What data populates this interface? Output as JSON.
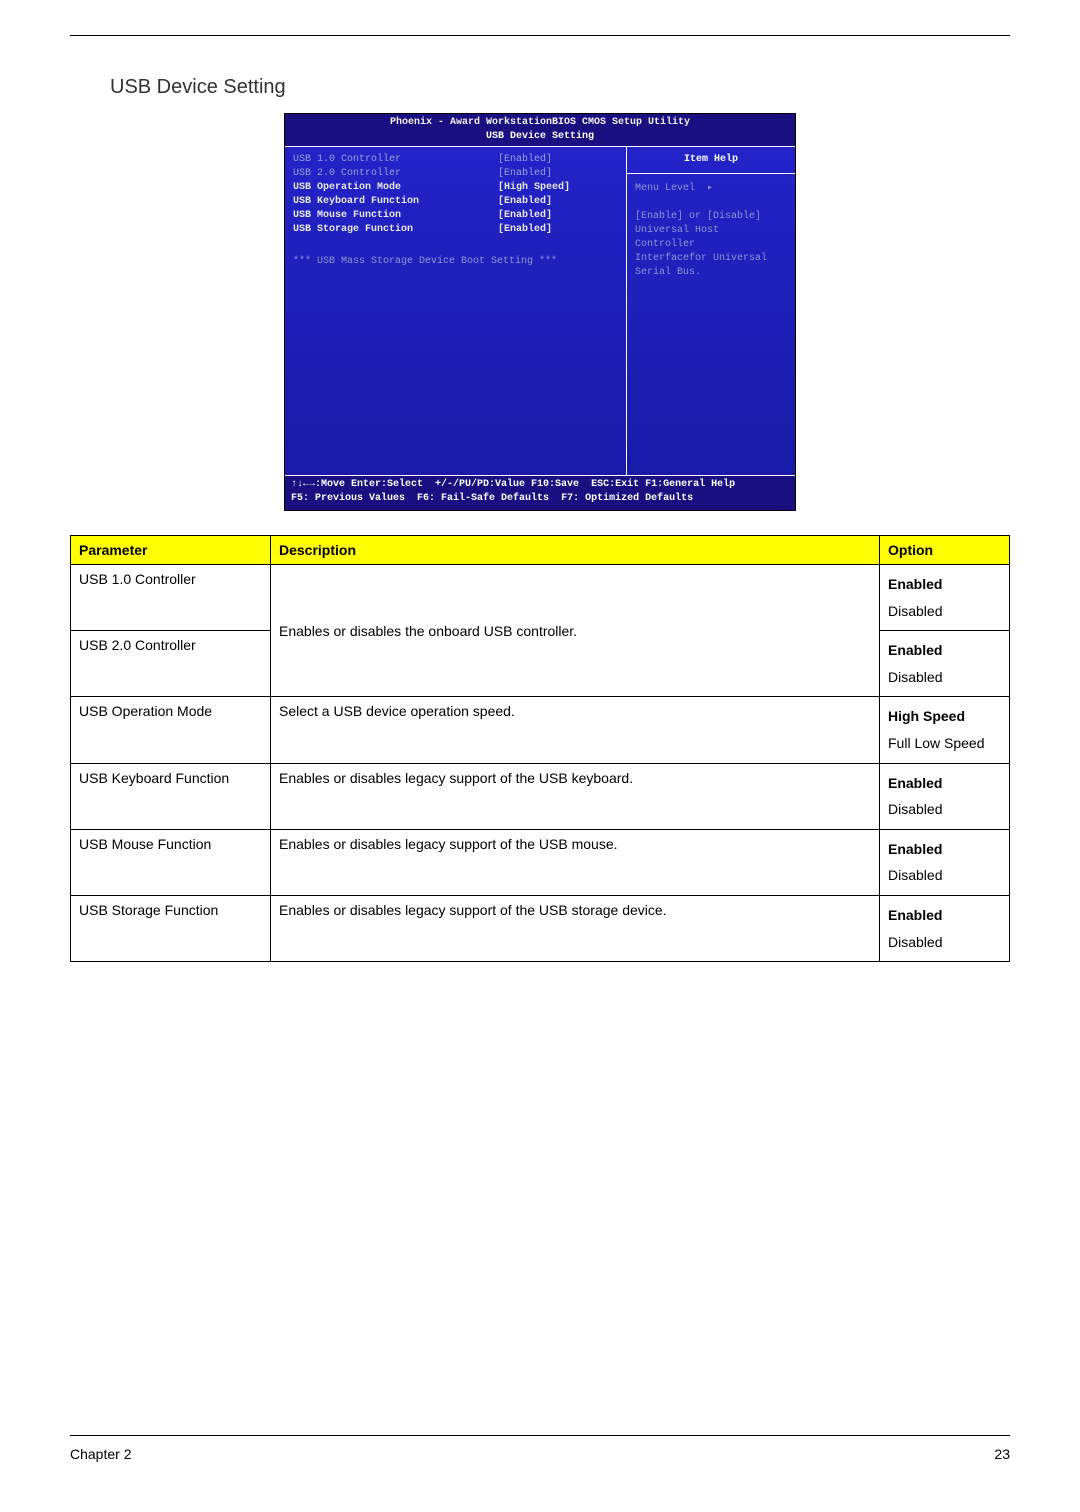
{
  "section_title": "USB Device Setting",
  "bios": {
    "title": "Phoenix - Award WorkstationBIOS CMOS Setup Utility",
    "subtitle": "USB Device Setting",
    "items": [
      {
        "label": "USB 1.0 Controller",
        "value": "[Enabled]",
        "dim": true
      },
      {
        "label": "USB 2.0 Controller",
        "value": "[Enabled]",
        "dim": true
      },
      {
        "label": "USB Operation Mode",
        "value": "[High Speed]",
        "dim": false
      },
      {
        "label": "USB Keyboard Function",
        "value": "[Enabled]",
        "dim": false
      },
      {
        "label": "USB Mouse Function",
        "value": "[Enabled]",
        "dim": false
      },
      {
        "label": "USB Storage Function",
        "value": "[Enabled]",
        "dim": false
      }
    ],
    "mass_storage_msg": "*** USB Mass Storage Device Boot Setting ***",
    "help_title": "Item Help",
    "menu_level": "Menu Level",
    "help_lines": [
      "[Enable] or [Disable]",
      "Universal Host",
      "Controller",
      "Interfacefor Universal",
      "Serial Bus."
    ],
    "footer1": {
      "a": "↑↓←→:Move  Enter:Select",
      "b": "+/-/PU/PD:Value  F10:Save",
      "c": "ESC:Exit  F1:General Help"
    },
    "footer2": {
      "a": "F5: Previous Values",
      "b": "F6: Fail-Safe Defaults",
      "c": "F7: Optimized Defaults"
    }
  },
  "table": {
    "headers": {
      "param": "Parameter",
      "desc": "Description",
      "opt": "Option"
    },
    "rows": [
      {
        "param": "USB 1.0 Controller",
        "span_desc": "Enables or disables the onboard USB controller.",
        "rowspan_desc": 2,
        "opts": [
          "Enabled",
          "Disabled"
        ],
        "bold_idx": 0
      },
      {
        "param": "USB 2.0 Controller",
        "opts": [
          "Enabled",
          "Disabled"
        ],
        "bold_idx": 0
      },
      {
        "param": "USB Operation Mode",
        "desc": "Select a USB device operation speed.",
        "opts": [
          "High Speed",
          "Full Low Speed"
        ],
        "bold_idx": 0
      },
      {
        "param": "USB Keyboard Function",
        "desc": "Enables or disables legacy support of the USB keyboard.",
        "opts": [
          "Enabled",
          "Disabled"
        ],
        "bold_idx": 0
      },
      {
        "param": "USB Mouse Function",
        "desc": "Enables or disables legacy support of the USB mouse.",
        "opts": [
          "Enabled",
          "Disabled"
        ],
        "bold_idx": 0
      },
      {
        "param": "USB Storage Function",
        "desc": "Enables or disables legacy support of the USB storage device.",
        "opts": [
          "Enabled",
          "Disabled"
        ],
        "bold_idx": 0
      }
    ]
  },
  "footer": {
    "chapter": "Chapter 2",
    "page": "23"
  }
}
